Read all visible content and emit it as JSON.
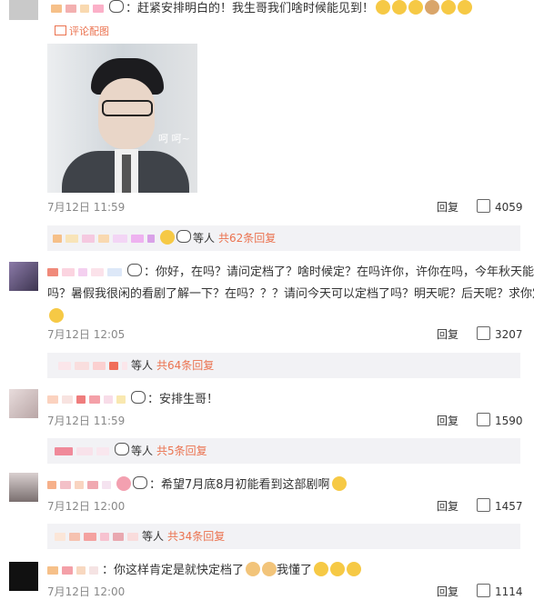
{
  "comments": [
    {
      "text": "：赶紧安排明白的！我生哥我们啥时候能见到！",
      "photo_link": "评论配图",
      "time": "7月12日 11:59",
      "reply_label": "回复",
      "likes": "4059",
      "replies_summary": "等人",
      "replies_count": "共62条回复"
    },
    {
      "text_line1": "：你好，在吗？请问定档了？啥时候定？在吗许你，许你在吗，今年秋天能定",
      "text_line2": "吗？暑假我很闲的看剧了解一下？在吗？？？请问今天可以定档了吗？明天呢？后天呢？求你定档",
      "time": "7月12日 12:05",
      "reply_label": "回复",
      "likes": "3207",
      "replies_summary": "等人",
      "replies_count": "共64条回复"
    },
    {
      "text": "：安排生哥！",
      "time": "7月12日 11:59",
      "reply_label": "回复",
      "likes": "1590",
      "replies_summary": "等人",
      "replies_count": "共5条回复"
    },
    {
      "text": "：希望7月底8月初能看到这部剧啊",
      "time": "7月12日 12:00",
      "reply_label": "回复",
      "likes": "1457",
      "replies_summary": "等人",
      "replies_count": "共34条回复"
    },
    {
      "text": "：你这样肯定是就快定档了",
      "text_suffix": "我懂了",
      "time": "7月12日 12:00",
      "reply_label": "回复",
      "likes": "1114"
    }
  ],
  "image_caption": "呵 呵~"
}
